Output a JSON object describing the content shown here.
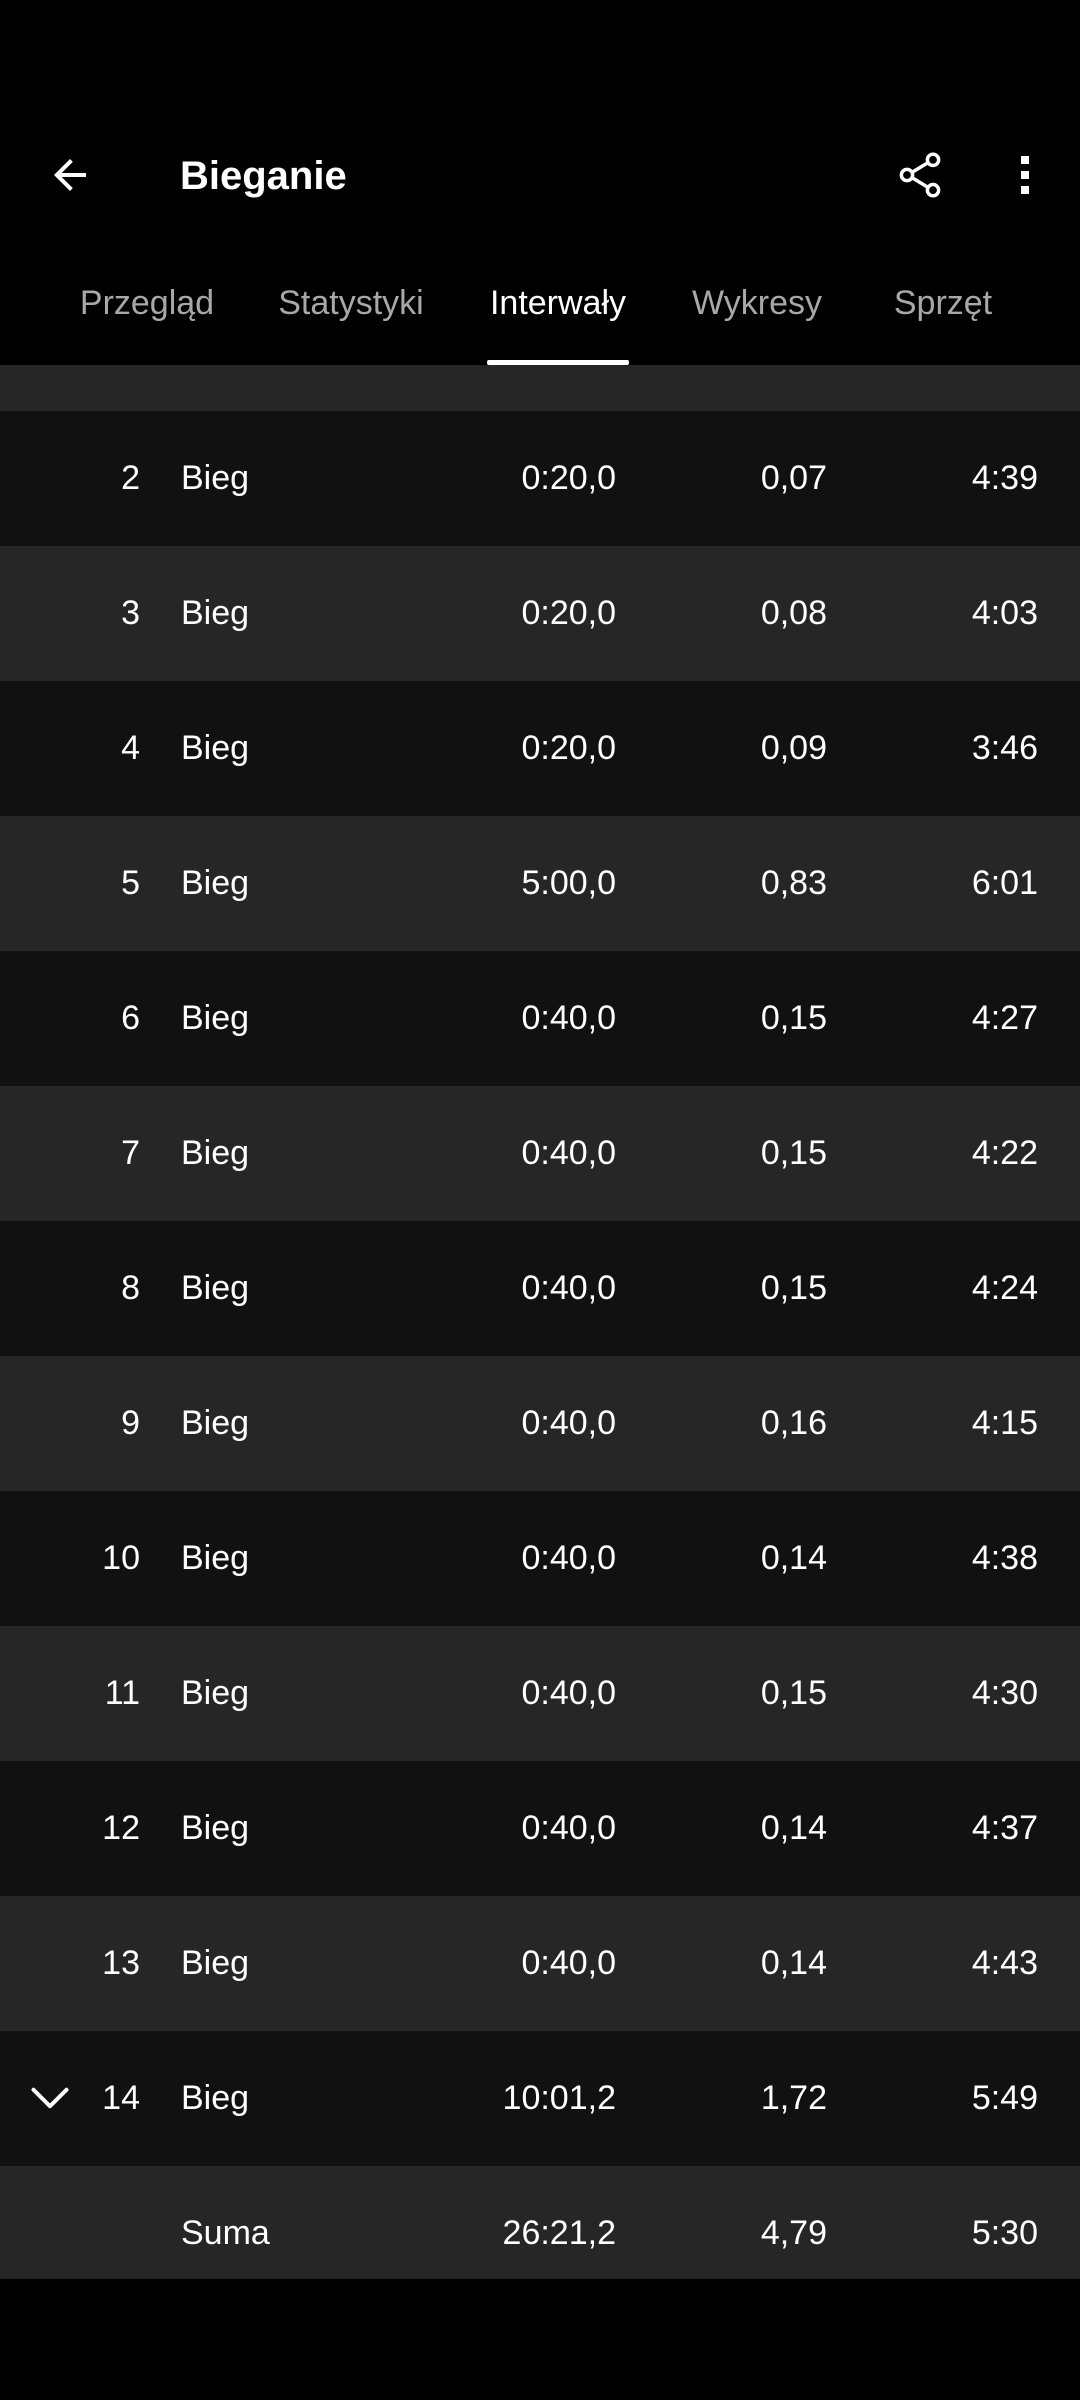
{
  "header": {
    "title": "Bieganie",
    "back_icon": "arrow-back-icon",
    "share_icon": "share-icon",
    "more_icon": "more-vert-icon"
  },
  "tabs": [
    {
      "label": "Przegląd",
      "active": false
    },
    {
      "label": "Statystyki",
      "active": false
    },
    {
      "label": "Interwały",
      "active": true
    },
    {
      "label": "Wykresy",
      "active": false
    },
    {
      "label": "Sprzęt",
      "active": false
    }
  ],
  "intervals": [
    {
      "num": "2",
      "type": "Bieg",
      "time": "0:20,0",
      "dist": "0,07",
      "pace": "4:39"
    },
    {
      "num": "3",
      "type": "Bieg",
      "time": "0:20,0",
      "dist": "0,08",
      "pace": "4:03"
    },
    {
      "num": "4",
      "type": "Bieg",
      "time": "0:20,0",
      "dist": "0,09",
      "pace": "3:46"
    },
    {
      "num": "5",
      "type": "Bieg",
      "time": "5:00,0",
      "dist": "0,83",
      "pace": "6:01"
    },
    {
      "num": "6",
      "type": "Bieg",
      "time": "0:40,0",
      "dist": "0,15",
      "pace": "4:27"
    },
    {
      "num": "7",
      "type": "Bieg",
      "time": "0:40,0",
      "dist": "0,15",
      "pace": "4:22"
    },
    {
      "num": "8",
      "type": "Bieg",
      "time": "0:40,0",
      "dist": "0,15",
      "pace": "4:24"
    },
    {
      "num": "9",
      "type": "Bieg",
      "time": "0:40,0",
      "dist": "0,16",
      "pace": "4:15"
    },
    {
      "num": "10",
      "type": "Bieg",
      "time": "0:40,0",
      "dist": "0,14",
      "pace": "4:38"
    },
    {
      "num": "11",
      "type": "Bieg",
      "time": "0:40,0",
      "dist": "0,15",
      "pace": "4:30"
    },
    {
      "num": "12",
      "type": "Bieg",
      "time": "0:40,0",
      "dist": "0,14",
      "pace": "4:37"
    },
    {
      "num": "13",
      "type": "Bieg",
      "time": "0:40,0",
      "dist": "0,14",
      "pace": "4:43"
    },
    {
      "num": "14",
      "type": "Bieg",
      "time": "10:01,2",
      "dist": "1,72",
      "pace": "5:49",
      "expandable": true,
      "icon": "chevron-down-icon"
    }
  ],
  "summary": {
    "label": "Suma",
    "time": "26:21,2",
    "dist": "4,79",
    "pace": "5:30"
  },
  "colors": {
    "background": "#000000",
    "row_dark": "#111111",
    "row_light": "#262626",
    "tab_inactive": "#a8a8a8",
    "text": "#ffffff"
  }
}
